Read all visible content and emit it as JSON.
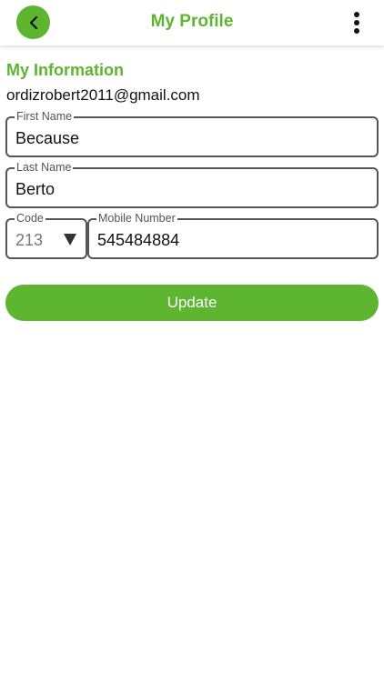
{
  "header": {
    "title": "My Profile",
    "back_icon": "chevron-left-icon",
    "menu_icon": "more-vertical-icon"
  },
  "section": {
    "title": "My Information",
    "email": "ordizrobert2011@gmail.com"
  },
  "form": {
    "first_name": {
      "label": "First Name",
      "value": "Because"
    },
    "last_name": {
      "label": "Last Name",
      "value": "Berto"
    },
    "code": {
      "label": "Code",
      "value": "213"
    },
    "mobile": {
      "label": "Mobile Number",
      "value": "545484884"
    }
  },
  "actions": {
    "update_label": "Update"
  },
  "colors": {
    "accent": "#5db530",
    "border": "#555555",
    "text": "#111111"
  }
}
